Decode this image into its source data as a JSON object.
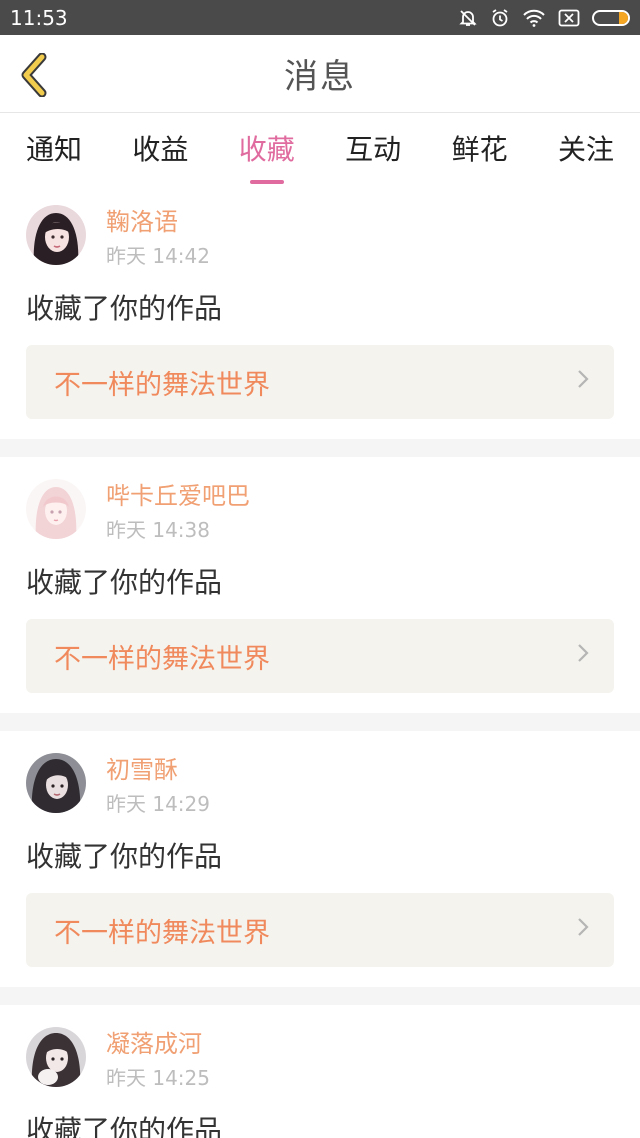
{
  "status_bar": {
    "time": "11:53",
    "icons": [
      "bell-off-icon",
      "alarm-icon",
      "wifi-icon",
      "close-box-icon",
      "battery-icon"
    ],
    "battery_color": "#f5a623"
  },
  "header": {
    "title": "消息",
    "back_icon": "chevron-left-icon",
    "accent": "#f2cc4c"
  },
  "tabs": {
    "items": [
      {
        "label": "通知"
      },
      {
        "label": "收益"
      },
      {
        "label": "收藏"
      },
      {
        "label": "互动"
      },
      {
        "label": "鲜花"
      },
      {
        "label": "关注"
      }
    ],
    "active_index": 2,
    "active_color": "#e06c9f"
  },
  "feed": {
    "items": [
      {
        "username": "鞠洛语",
        "time": "昨天 14:42",
        "action": "收藏了你的作品",
        "work_title": "不一样的舞法世界"
      },
      {
        "username": "哔卡丘爱吧巴",
        "time": "昨天 14:38",
        "action": "收藏了你的作品",
        "work_title": "不一样的舞法世界"
      },
      {
        "username": "初雪酥",
        "time": "昨天 14:29",
        "action": "收藏了你的作品",
        "work_title": "不一样的舞法世界"
      },
      {
        "username": "凝落成河",
        "time": "昨天 14:25",
        "action": "收藏了你的作品",
        "work_title": ""
      }
    ]
  }
}
